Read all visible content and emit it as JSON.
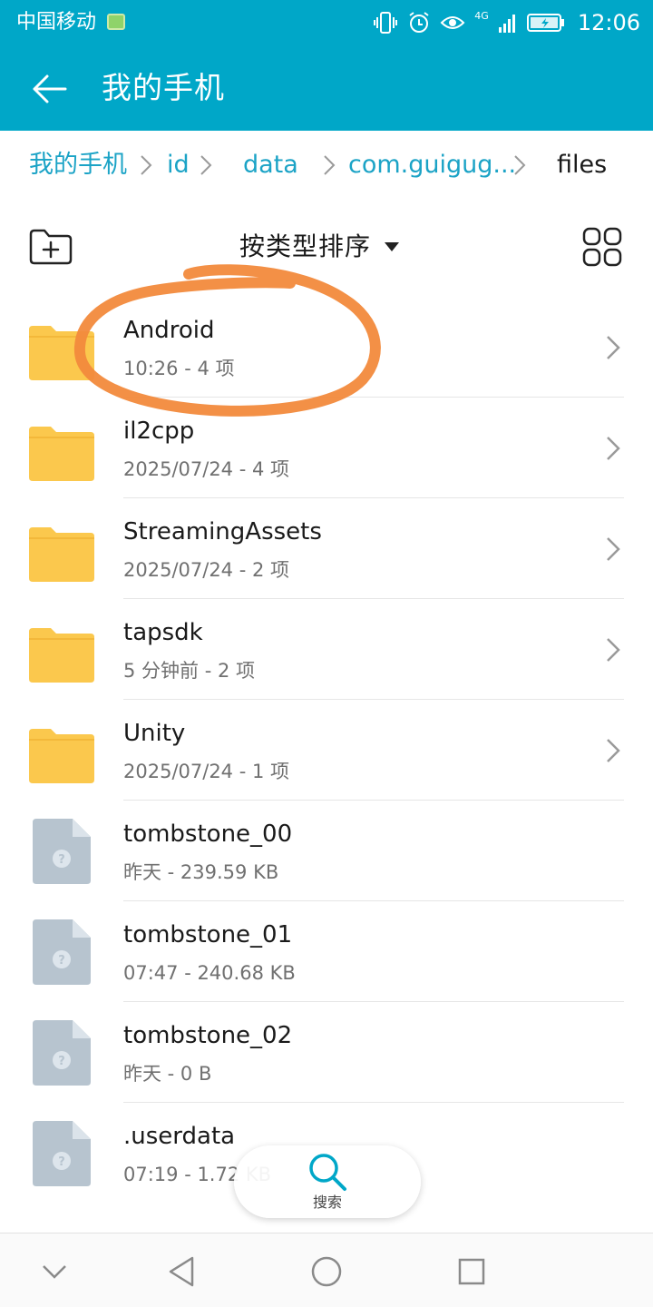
{
  "status_bar": {
    "carrier": "中国移动",
    "network": "4G",
    "time": "12:06"
  },
  "app_bar": {
    "title": "我的手机"
  },
  "breadcrumb": [
    {
      "label": "我的手机",
      "current": false
    },
    {
      "label": "id",
      "current": false
    },
    {
      "label": "data",
      "current": false
    },
    {
      "label": "com.guigug...",
      "current": false
    },
    {
      "label": "files",
      "current": true
    }
  ],
  "toolbar": {
    "sort_label": "按类型排序"
  },
  "items": [
    {
      "type": "folder",
      "name": "Android",
      "meta": "10:26 - 4 项"
    },
    {
      "type": "folder",
      "name": "il2cpp",
      "meta": "2025/07/24 - 4 项"
    },
    {
      "type": "folder",
      "name": "StreamingAssets",
      "meta": "2025/07/24 - 2 项"
    },
    {
      "type": "folder",
      "name": "tapsdk",
      "meta": "5 分钟前 - 2 项"
    },
    {
      "type": "folder",
      "name": "Unity",
      "meta": "2025/07/24 - 1 项"
    },
    {
      "type": "file",
      "name": "tombstone_00",
      "meta": "昨天 - 239.59 KB"
    },
    {
      "type": "file",
      "name": "tombstone_01",
      "meta": "07:47 - 240.68 KB"
    },
    {
      "type": "file",
      "name": "tombstone_02",
      "meta": "昨天 - 0 B"
    },
    {
      "type": "file",
      "name": ".userdata",
      "meta": "07:19 - 1.72 KB"
    }
  ],
  "search_fab": {
    "label": "搜索"
  },
  "colors": {
    "accent": "#00a7c8",
    "link": "#1ba3c6",
    "folder": "#fbc84d",
    "file": "#b7c4cf",
    "annotation": "#f28a3c"
  }
}
